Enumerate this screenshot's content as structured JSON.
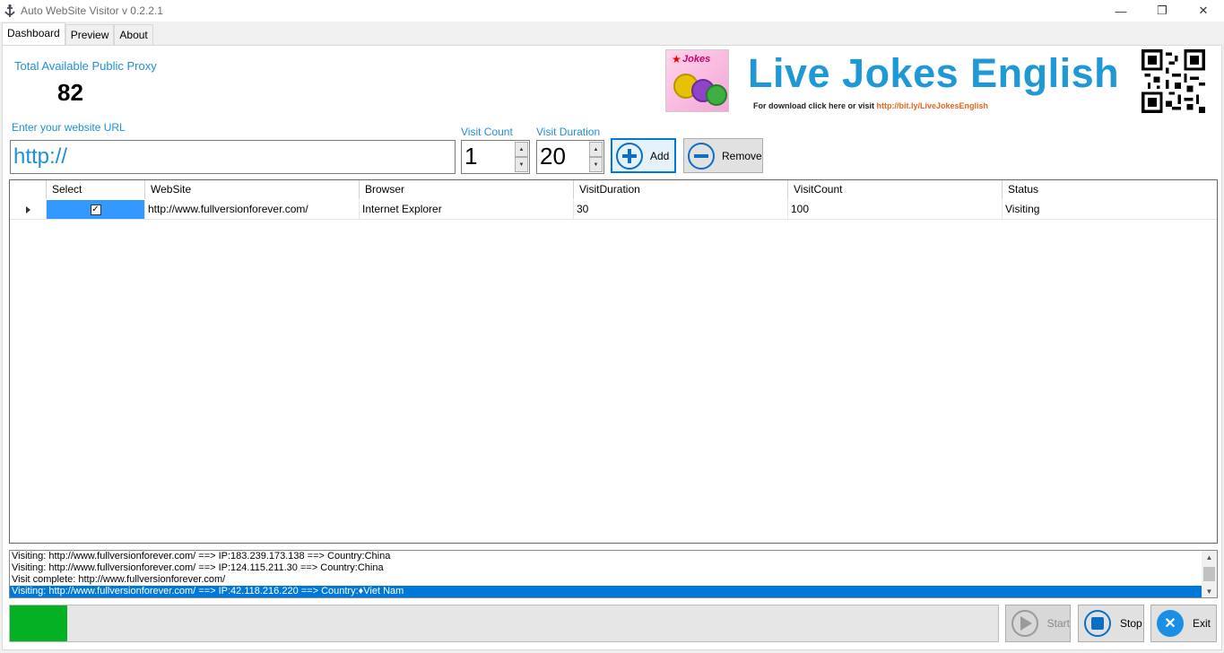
{
  "window": {
    "title": "Auto WebSite Visitor v 0.2.2.1",
    "minimize_glyph": "—",
    "maximize_glyph": "❐",
    "close_glyph": "✕"
  },
  "tabs": [
    {
      "label": "Dashboard",
      "active": true
    },
    {
      "label": "Preview",
      "active": false
    },
    {
      "label": "About",
      "active": false
    }
  ],
  "proxy": {
    "label": "Total Available Public Proxy",
    "count": "82"
  },
  "banner": {
    "logo_text": "Jokes",
    "title": "Live Jokes English",
    "subtitle": "For download click here  or visit ",
    "link": "http://bit.ly/LiveJokesEnglish",
    "title_color": "#1f98d6",
    "link_color": "#e8661a"
  },
  "url_input": {
    "label": "Enter your website URL",
    "value": "http://"
  },
  "visit_count": {
    "label": "Visit Count",
    "value": "1"
  },
  "visit_duration": {
    "label": "Visit Duration",
    "value": "20"
  },
  "buttons": {
    "add": "Add",
    "remove": "Remove",
    "start": "Start",
    "stop": "Stop",
    "exit": "Exit"
  },
  "grid": {
    "columns": [
      "Select",
      "WebSite",
      "Browser",
      "VisitDuration",
      "VisitCount",
      "Status"
    ],
    "rows": [
      {
        "selected": true,
        "website": "http://www.fullversionforever.com/",
        "browser": "Internet Explorer",
        "visit_duration": "30",
        "visit_count": "100",
        "status": "Visiting"
      }
    ]
  },
  "log": [
    "Visiting: http://www.fullversionforever.com/ ==> IP:183.239.173.138 ==> Country:China",
    "Visiting: http://www.fullversionforever.com/ ==> IP:124.115.211.30 ==> Country:China",
    "Visit complete: http://www.fullversionforever.com/",
    "Visiting: http://www.fullversionforever.com/ ==> IP:42.118.216.220 ==> Country:♦Viet Nam"
  ],
  "progress": {
    "fraction": 0.058,
    "color": "#06b025"
  },
  "colors": {
    "accent_blue": "#1e90d8",
    "selection_blue": "#3399ff",
    "icon_blue": "#0d6ec6"
  }
}
